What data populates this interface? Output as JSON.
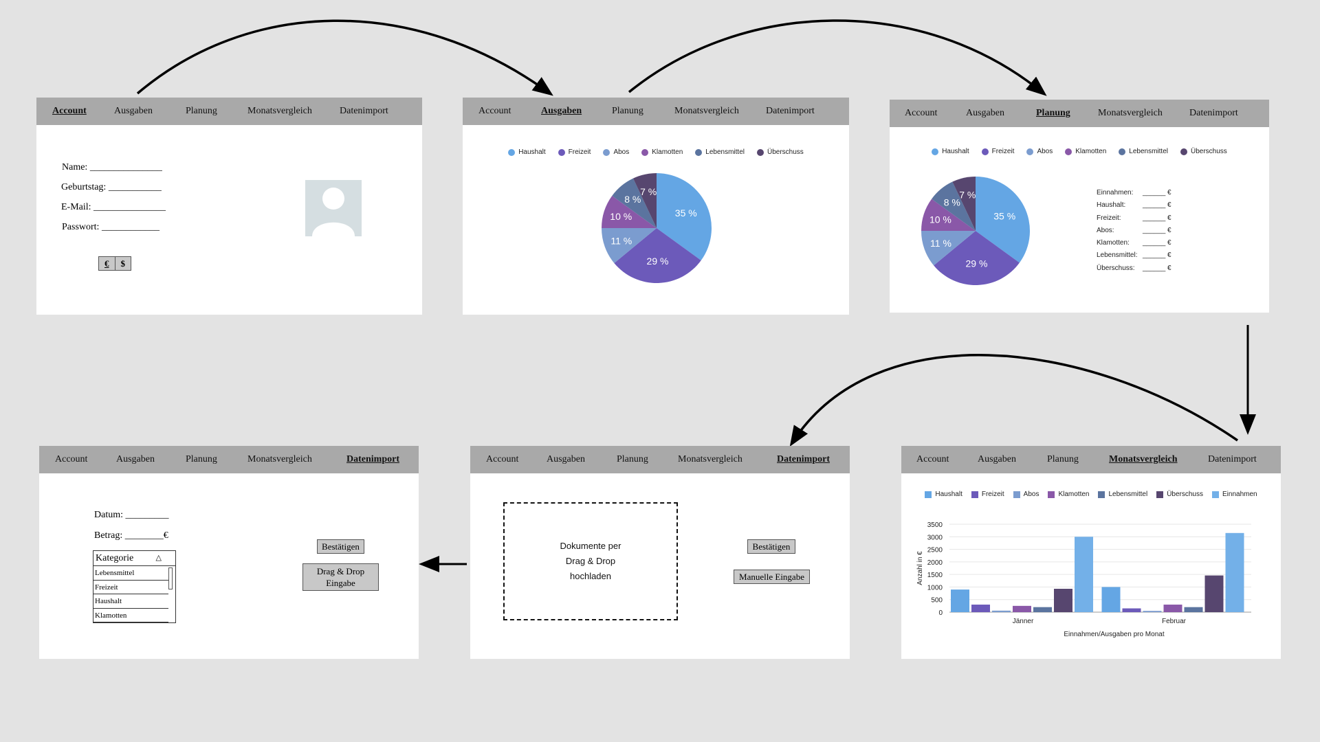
{
  "nav_items": [
    "Account",
    "Ausgaben",
    "Planung",
    "Monatsvergleich",
    "Datenimport"
  ],
  "colors": {
    "haushalt": "#64a6e4",
    "freizeit": "#6c5aba",
    "abos": "#7b9ccf",
    "klamotten": "#8a58a8",
    "lebensmittel": "#5b749f",
    "ueberschuss": "#57466f",
    "einnahmen": "#73b0e8"
  },
  "account_screen": {
    "fields": [
      {
        "label": "Name:",
        "line": "_______________"
      },
      {
        "label": "Geburtstag:",
        "line": "___________"
      },
      {
        "label": "E-Mail:",
        "line": "_______________"
      },
      {
        "label": "Passwort:",
        "line": "____________"
      }
    ],
    "currency_toggle": {
      "euro": "€",
      "dollar": "$"
    },
    "avatar_icon": "user-placeholder-icon"
  },
  "expense_legend": [
    "Haushalt",
    "Freizeit",
    "Abos",
    "Klamotten",
    "Lebensmittel",
    "Überschuss"
  ],
  "chart_data": [
    {
      "type": "pie",
      "title": "",
      "labels": [
        "Haushalt",
        "Freizeit",
        "Abos",
        "Klamotten",
        "Lebensmittel",
        "Überschuss"
      ],
      "values": [
        35,
        29,
        11,
        10,
        8,
        7
      ],
      "value_labels": [
        "35 %",
        "29 %",
        "11 %",
        "10 %",
        "8 %",
        "7 %"
      ]
    },
    {
      "type": "pie",
      "title": "",
      "labels": [
        "Haushalt",
        "Freizeit",
        "Abos",
        "Klamotten",
        "Lebensmittel",
        "Überschuss"
      ],
      "values": [
        35,
        29,
        11,
        10,
        8,
        7
      ],
      "value_labels": [
        "35 %",
        "29 %",
        "11 %",
        "10 %",
        "8 %",
        "7 %"
      ]
    },
    {
      "type": "bar",
      "categories": [
        "Jänner",
        "Februar"
      ],
      "series": [
        {
          "name": "Haushalt",
          "values": [
            900,
            1000
          ]
        },
        {
          "name": "Freizeit",
          "values": [
            300,
            150
          ]
        },
        {
          "name": "Abos",
          "values": [
            60,
            50
          ]
        },
        {
          "name": "Klamotten",
          "values": [
            250,
            300
          ]
        },
        {
          "name": "Lebensmittel",
          "values": [
            200,
            200
          ]
        },
        {
          "name": "Überschuss",
          "values": [
            930,
            1460
          ]
        },
        {
          "name": "Einnahmen",
          "values": [
            3000,
            3150
          ]
        }
      ],
      "ylim": [
        0,
        3500
      ],
      "yticks": [
        0,
        500,
        1000,
        1500,
        2000,
        2500,
        3000,
        3500
      ],
      "xlabel": "Einnahmen/Ausgaben pro Monat",
      "ylabel": "Anzahl in €",
      "legend_position": "top"
    }
  ],
  "planning_screen": {
    "rows": [
      {
        "label": "Einnahmen:",
        "line": "______",
        "unit": "€"
      },
      {
        "label": "Haushalt:",
        "line": "______",
        "unit": "€"
      },
      {
        "label": "Freizeit:",
        "line": "______",
        "unit": "€"
      },
      {
        "label": "Abos:",
        "line": "______",
        "unit": "€"
      },
      {
        "label": "Klamotten:",
        "line": "______",
        "unit": "€"
      },
      {
        "label": "Lebensmittel:",
        "line": "______",
        "unit": "€"
      },
      {
        "label": "Überschuss:",
        "line": "______",
        "unit": "€"
      }
    ]
  },
  "import_screen": {
    "dropzone_lines": [
      "Dokumente per",
      "Drag & Drop",
      "hochladen"
    ],
    "confirm_label": "Bestätigen",
    "manual_label": "Manuelle Eingabe"
  },
  "manual_screen": {
    "date_label": "Datum:",
    "date_line": "_________",
    "amount_label": "Betrag:",
    "amount_line": "________",
    "amount_unit": "€",
    "category_label": "Kategorie",
    "category_options": [
      "Lebensmittel",
      "Freizeit",
      "Haushalt",
      "Klamotten"
    ],
    "confirm_label": "Bestätigen",
    "dragdrop_label_1": "Drag & Drop",
    "dragdrop_label_2": "Eingabe"
  }
}
